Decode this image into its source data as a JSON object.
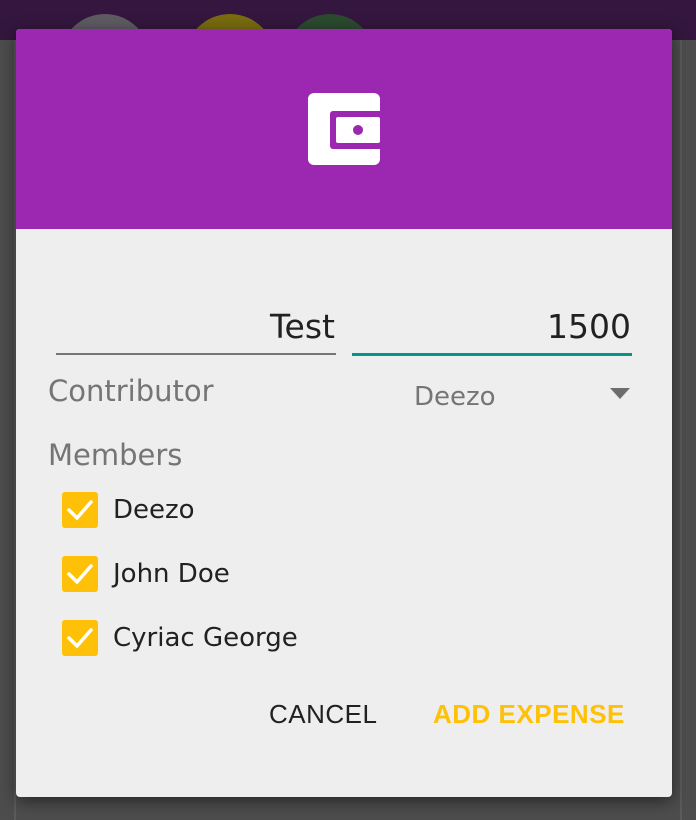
{
  "dialog": {
    "icon": "wallet-icon",
    "accent_color": "#9c27b0",
    "title_value": "Test",
    "amount_value": "1500",
    "contributor_label": "Contributor",
    "contributor_selected": "Deezo",
    "members_label": "Members",
    "members": [
      {
        "name": "Deezo",
        "checked": true
      },
      {
        "name": "John Doe",
        "checked": true
      },
      {
        "name": "Cyriac George",
        "checked": true
      }
    ],
    "cancel_label": "CANCEL",
    "add_label": "ADD EXPENSE",
    "checkbox_color": "#ffc107",
    "focus_color": "#009688"
  }
}
